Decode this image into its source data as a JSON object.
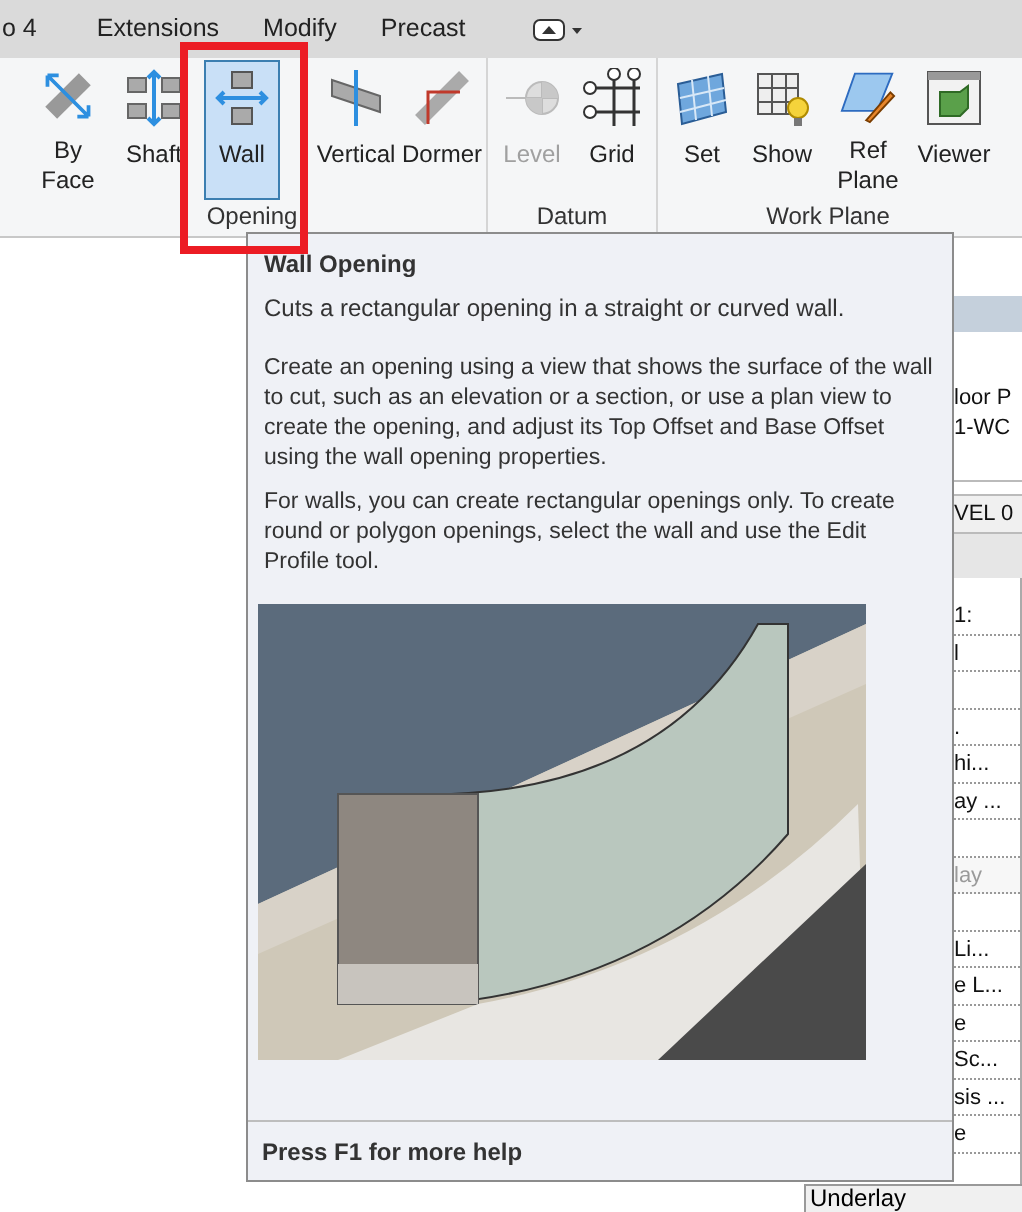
{
  "ribbon_tabs": [
    {
      "label": "o 4"
    },
    {
      "label": "Extensions"
    },
    {
      "label": "Modify"
    },
    {
      "label": "Precast"
    }
  ],
  "panels": [
    {
      "title": "Opening",
      "tools": [
        {
          "label": "By Face",
          "selected": false,
          "disabled": false,
          "highlight_box": false
        },
        {
          "label": "Shaft",
          "selected": false,
          "disabled": false,
          "highlight_box": false
        },
        {
          "label": "Wall",
          "selected": true,
          "disabled": false,
          "highlight_box": true
        },
        {
          "label": "Vertical",
          "selected": false,
          "disabled": false,
          "highlight_box": false
        },
        {
          "label": "Dormer",
          "selected": false,
          "disabled": false,
          "highlight_box": false
        }
      ]
    },
    {
      "title": "Datum",
      "tools": [
        {
          "label": "Level",
          "selected": false,
          "disabled": true,
          "highlight_box": false
        },
        {
          "label": "Grid",
          "selected": false,
          "disabled": false,
          "highlight_box": false
        }
      ]
    },
    {
      "title": "Work Plane",
      "tools": [
        {
          "label": "Set",
          "selected": false,
          "disabled": false,
          "highlight_box": false
        },
        {
          "label": "Show",
          "selected": false,
          "disabled": false,
          "highlight_box": false
        },
        {
          "label": "Ref Plane",
          "selected": false,
          "disabled": false,
          "highlight_box": false
        },
        {
          "label": "Viewer",
          "selected": false,
          "disabled": false,
          "highlight_box": false
        }
      ]
    }
  ],
  "side_panel": {
    "header_lines": [
      "loor P",
      "1-WC"
    ],
    "level_row": "VEL 0",
    "rows": [
      {
        "kind": "text",
        "text": "1:",
        "disabled": false
      },
      {
        "kind": "text",
        "text": "l",
        "disabled": false
      },
      {
        "kind": "blank"
      },
      {
        "kind": "text",
        "text": ".",
        "disabled": false
      },
      {
        "kind": "text",
        "text": "hi...",
        "disabled": false
      },
      {
        "kind": "text",
        "text": "ay ...",
        "disabled": false
      },
      {
        "kind": "blank"
      },
      {
        "kind": "text",
        "text": "lay",
        "disabled": true
      },
      {
        "kind": "blank"
      },
      {
        "kind": "text",
        "text": "Li...",
        "disabled": false
      },
      {
        "kind": "text",
        "text": "e L...",
        "disabled": false
      },
      {
        "kind": "text",
        "text": "e",
        "disabled": false
      },
      {
        "kind": "text",
        "text": "Sc...",
        "disabled": false
      },
      {
        "kind": "text",
        "text": "sis ...",
        "disabled": false
      },
      {
        "kind": "text",
        "text": "e",
        "disabled": false
      }
    ],
    "footer": "Underlay"
  },
  "tooltip": {
    "title": "Wall Opening",
    "summary": "Cuts a rectangular opening in a straight or curved wall.",
    "paragraphs": [
      "Create an opening using a view that shows the surface of the wall to cut, such as an elevation or a section, or use a plan view to create the opening, and adjust its Top Offset and Base Offset using the wall opening properties.",
      "For walls, you can create rectangular openings only. To create round or polygon openings, select the wall and use the Edit Profile tool."
    ],
    "footer": "Press F1 for more help"
  }
}
